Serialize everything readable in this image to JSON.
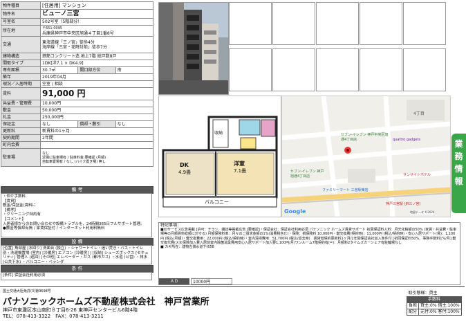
{
  "spec": {
    "type_label": "物件種目",
    "type_value": "[住居用] マンション",
    "name_label": "物件名",
    "name_value": "ビューノ三宮",
    "room_label": "号室名",
    "room_value": "502号室（5階部分）",
    "addr_label": "所在地",
    "postal": "〒651-0095",
    "addr_value": "兵庫県神戸市中央区旭通４丁目1番8号",
    "traffic_label": "交通",
    "traffic_1": "東海道線「三ノ宮」徒歩4分",
    "traffic_2": "海岸線「三宮・花時計前」徒歩7分",
    "struct_label": "建物構造",
    "struct_value": "鉄筋コンクリート造 地上7階 総戸数8戸",
    "layout_label": "間取タイプ",
    "layout_value": "1DK[洋7.1 × DK4.9]",
    "area_label": "専有面積",
    "area_value": "30.7㎡",
    "dir_label": "開口部方位",
    "dir_value": "南",
    "age_label": "築年",
    "age_value": "2019年04月",
    "status_label": "現況／入居時期",
    "status_value": "空室 / 相談",
    "rent_label": "賃料",
    "rent_value": "91,000 円",
    "fee_label": "共益費・管理費",
    "fee_value": "10,000円",
    "deposit_label": "敷金",
    "deposit_value": "50,000円",
    "key_label": "礼金",
    "key_value": "250,000円",
    "guar_label": "保証金",
    "guar_value": "なし",
    "sho_label": "償却・敷引",
    "sho_value": "なし",
    "renew_label": "更新料",
    "renew_value": "新賃料の1ヶ月",
    "term_label": "契約期間",
    "term_value": "2年間",
    "comm_label": "町内会費",
    "comm_value": "",
    "park_label": "駐車場",
    "park_1": "なし",
    "park_2": "近隣に駐車場有 / 駐車料金:要確認 (月額)",
    "park_3": "自転車置場有 / なし (バイク置き場) 無し"
  },
  "remarks": {
    "title": "備 考",
    "lines": [
      "・仲介手数料",
      "【賃貸】",
      "敷金/保証金(賃料に",
      "【備考】",
      "・クリーニング特約有",
      "【コメント】",
      "入居者様からのお問い合わせや設備トラブルを、24時間365日フルサポート管理。",
      "●敷金等償却有無 / 家賃保証付 / インターネット利用料無料"
    ]
  },
  "equip": {
    "title": "設 備",
    "text": "[位置] 角部屋 [水回り] 洗面台 (独立) ・シャワートイレ・追い焚き・バス・トイレ別・洗濯機置場 (室内) [冷暖房] エアコン [冷暖房] | [収納] シューズボックス [セキュリティ] 管理人 (巡回) [その他] エレベーター・ガス (都市ガス) ・水道 (公営) ・排水 (公共下水) ・バルコニー・ベランダ"
  },
  "conditions": {
    "title": "条 件",
    "text": "[条件] 保証会社利用必須"
  },
  "plan": {
    "storage": "収納",
    "dk": "DK",
    "dk_size": "4.9畳",
    "western": "洋室",
    "western_size": "7.1畳",
    "balcony": "バルコニー"
  },
  "map": {
    "label_4": "4丁目",
    "label_1": "1",
    "seven": "セブン-イレブン 神戸中央区旭通4丁目店",
    "quattro": "quattro gadgets",
    "seven2": "セブン-イレブン 神戸旭通4丁目店",
    "family": "ファミリーマート 三宮駅東店",
    "station": "神戸三宮駅 (JR三ノ宮)",
    "sunsate": "サンサイトホテル",
    "chrome": "Google",
    "copyright": "地図データ ©2024"
  },
  "notes": {
    "title": "特記事項：",
    "text": "■IDサービス広告掲載 [許可：チラシ、雑誌等掲載広告 [要確認]・保証会社：保証会社利用必須 パナソニック ホームズ賃貸サポート 初回保証料入料：月光化粧額の50% (家賃・共益費・駐車場等の月額賃料総額に対する) 月額保険料率：月々のご請求金額の1%(消費税含む)・保険：損保険料 10,000円・鍵交換費(契約時)：11,000円 (税込/契約時)・安心入居サポート(賃)：1,100円 (税込/月額)・鍵交換費用：22,000円 (税込/契約時)・室内清掃費用：51,700円 (税込/退去時)　賃貸借契約更新料1ヶ月/2年間保証会社加入条件付 [初回保証料50%、事務手数料1%/月] 鍵交換代費(火災保険加入費入居前室内除菌消臭費用安心入居サポート加入要1,100円/月)ワンルーム7階契約有(=)：月額料2タイムズカーシェア有駐輪場なし",
    "note2": "■ カギ所在：建物左側水道下(658",
    "ad_label": "ＡＤ",
    "ad_value": "10000円"
  },
  "company": {
    "license": "国土交通大臣免許(3)第9698号",
    "name": "パナソニックホームズ不動産株式会社　神戸営業所",
    "address": "神戸市東灘区本山南町８丁目6-26 東神戸センタービル6階4階",
    "tel": "TEL：078-413-3322　FAX：078-413-3211"
  },
  "deal": {
    "form_label": "取引態様：",
    "form_value": "貸主",
    "fee_header": "手数料",
    "row1_l": "負担",
    "row1_r": "貸主:0% 借主:100%",
    "row2_l": "配分",
    "row2_r": "元付:0% 客付:100%"
  },
  "tag": {
    "text": "業務情報"
  }
}
